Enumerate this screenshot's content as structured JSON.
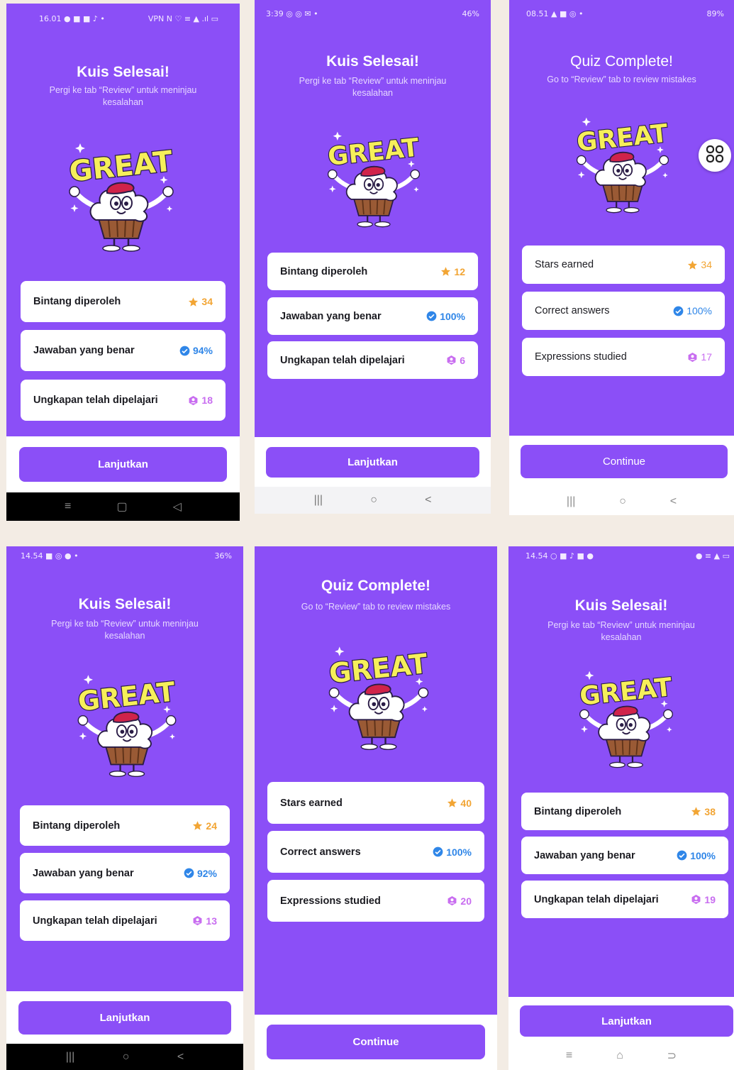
{
  "screens": [
    {
      "status_time": "16.01",
      "status_icons_left": "● ■ ■ ♪  •",
      "status_icons_right": "VPN N ♡ ≡ ▲ .ıl ▭",
      "title": "Kuis Selesai!",
      "subtitle": "Pergi ke tab “Review” untuk meninjau kesalahan",
      "stats": [
        {
          "label": "Bintang diperoleh",
          "value": "34",
          "icon": "star-icon"
        },
        {
          "label": "Jawaban yang benar",
          "value": "94%",
          "icon": "check-badge-icon"
        },
        {
          "label": "Ungkapan telah dipelajari",
          "value": "18",
          "icon": "expression-icon"
        }
      ],
      "button": "Lanjutkan",
      "nav": [
        "≡",
        "▢",
        "◁"
      ]
    },
    {
      "status_time": "3:39",
      "status_icons_left": "◎ ◎ ✉ •",
      "status_icons_right": "46%",
      "title": "Kuis Selesai!",
      "subtitle": "Pergi ke tab “Review” untuk meninjau kesalahan",
      "stats": [
        {
          "label": "Bintang diperoleh",
          "value": "12",
          "icon": "star-icon"
        },
        {
          "label": "Jawaban yang benar",
          "value": "100%",
          "icon": "check-badge-icon"
        },
        {
          "label": "Ungkapan telah dipelajari",
          "value": "6",
          "icon": "expression-icon"
        }
      ],
      "button": "Lanjutkan",
      "nav": [
        "|||",
        "○",
        "<"
      ]
    },
    {
      "status_time": "08.51",
      "status_icons_left": "▲ ■ ◎ •",
      "status_icons_right": "89%",
      "title": "Quiz Complete!",
      "subtitle": "Go to “Review” tab to review mistakes",
      "stats": [
        {
          "label": "Stars earned",
          "value": "34",
          "icon": "star-icon"
        },
        {
          "label": "Correct answers",
          "value": "100%",
          "icon": "check-badge-icon"
        },
        {
          "label": "Expressions studied",
          "value": "17",
          "icon": "expression-icon"
        }
      ],
      "button": "Continue",
      "nav": [
        "|||",
        "○",
        "<"
      ]
    },
    {
      "status_time": "14.54",
      "status_icons_left": "■ ◎ ● •",
      "status_icons_right": "36%",
      "title": "Kuis Selesai!",
      "subtitle": "Pergi ke tab “Review” untuk meninjau kesalahan",
      "stats": [
        {
          "label": "Bintang diperoleh",
          "value": "24",
          "icon": "star-icon"
        },
        {
          "label": "Jawaban yang benar",
          "value": "92%",
          "icon": "check-badge-icon"
        },
        {
          "label": "Ungkapan telah dipelajari",
          "value": "13",
          "icon": "expression-icon"
        }
      ],
      "button": "Lanjutkan",
      "nav": [
        "|||",
        "○",
        "<"
      ]
    },
    {
      "status_time": "",
      "status_icons_left": "",
      "status_icons_right": "",
      "title": "Quiz Complete!",
      "subtitle": "Go to “Review” tab to review mistakes",
      "stats": [
        {
          "label": "Stars earned",
          "value": "40",
          "icon": "star-icon"
        },
        {
          "label": "Correct answers",
          "value": "100%",
          "icon": "check-badge-icon"
        },
        {
          "label": "Expressions studied",
          "value": "20",
          "icon": "expression-icon"
        }
      ],
      "button": "Continue",
      "nav": []
    },
    {
      "status_time": "14.54",
      "status_icons_left": "○ ■ ♪ ■ ●",
      "status_icons_right": "● ≡ ▲ ▭",
      "title": "Kuis Selesai!",
      "subtitle": "Pergi ke tab “Review” untuk meninjau kesalahan",
      "stats": [
        {
          "label": "Bintang diperoleh",
          "value": "38",
          "icon": "star-icon"
        },
        {
          "label": "Jawaban yang benar",
          "value": "100%",
          "icon": "check-badge-icon"
        },
        {
          "label": "Ungkapan telah dipelajari",
          "value": "19",
          "icon": "expression-icon"
        }
      ],
      "button": "Lanjutkan",
      "nav": [
        "≡",
        "⌂",
        "⊃"
      ]
    }
  ],
  "mascot_text": "GREAT",
  "colors": {
    "primary": "#8b4ff7",
    "star": "#f2a534",
    "check": "#2f86e8",
    "expression": "#c86df0",
    "mascot_yellow": "#f6ef5a"
  }
}
